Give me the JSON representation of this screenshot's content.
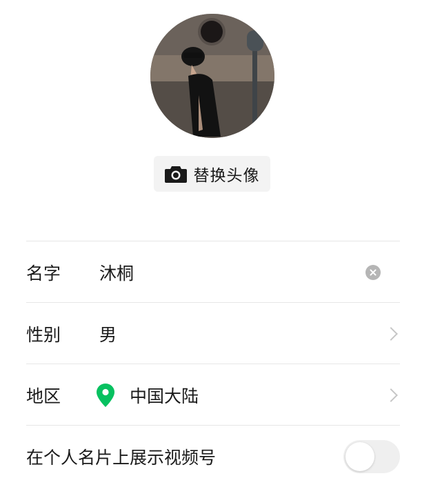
{
  "profile": {
    "change_avatar_label": "替换头像"
  },
  "form": {
    "name": {
      "label": "名字",
      "value": "沐桐"
    },
    "gender": {
      "label": "性别",
      "value": "男"
    },
    "region": {
      "label": "地区",
      "value": "中国大陆"
    },
    "show_channels": {
      "label": "在个人名片上展示视频号",
      "enabled": false
    }
  },
  "colors": {
    "location_pin": "#07c160",
    "toggle_off": "#efefef",
    "divider": "#e6e6e6"
  }
}
